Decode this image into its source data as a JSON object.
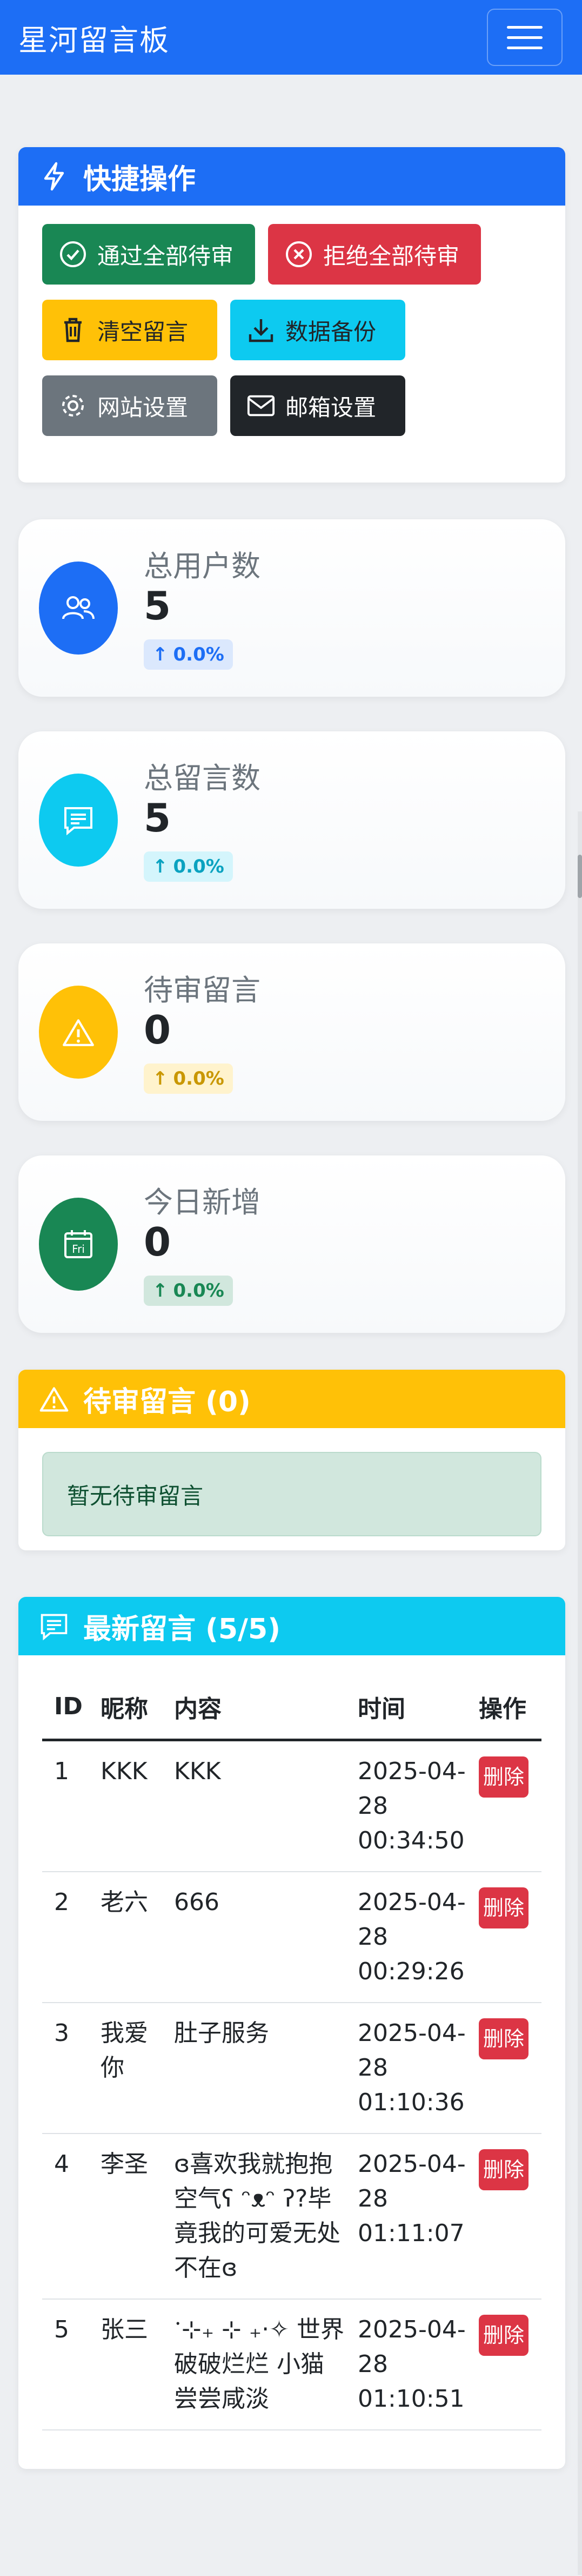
{
  "navbar": {
    "brand": "星河留言板"
  },
  "quick_actions": {
    "title": "快捷操作",
    "buttons": [
      {
        "label": "通过全部待审",
        "icon": "check-circle-icon",
        "color": "#198754"
      },
      {
        "label": "拒绝全部待审",
        "icon": "x-circle-icon",
        "color": "#dc3545"
      },
      {
        "label": "清空留言",
        "icon": "trash-icon",
        "color": "#ffc107"
      },
      {
        "label": "数据备份",
        "icon": "download-icon",
        "color": "#0dcaf0"
      },
      {
        "label": "网站设置",
        "icon": "gear-icon",
        "color": "#6c757d"
      },
      {
        "label": "邮箱设置",
        "icon": "envelope-icon",
        "color": "#212529"
      }
    ]
  },
  "stats": [
    {
      "title": "总用户数",
      "value": "5",
      "change": "0.0%",
      "icon": "users-icon",
      "color": "#1d6ef5"
    },
    {
      "title": "总留言数",
      "value": "5",
      "change": "0.0%",
      "icon": "chat-icon",
      "color": "#0dcaf0"
    },
    {
      "title": "待审留言",
      "value": "0",
      "change": "0.0%",
      "icon": "warning-icon",
      "color": "#ffc107"
    },
    {
      "title": "今日新增",
      "value": "0",
      "change": "0.0%",
      "icon": "calendar-icon",
      "color": "#198754",
      "icon_text": "Fri"
    }
  ],
  "pending": {
    "title": "待审留言 (0)",
    "empty_text": "暂无待审留言"
  },
  "latest": {
    "title": "最新留言 (5/5)",
    "columns": [
      "ID",
      "昵称",
      "内容",
      "时间",
      "操作"
    ],
    "delete_label": "删除",
    "rows": [
      {
        "id": "1",
        "nick": "KKK",
        "content": "KKK",
        "time": "2025-04-28 00:34:50"
      },
      {
        "id": "2",
        "nick": "老六",
        "content": "666",
        "time": "2025-04-28 00:29:26"
      },
      {
        "id": "3",
        "nick": "我爱你",
        "content": "肚子服务",
        "time": "2025-04-28 01:10:36"
      },
      {
        "id": "4",
        "nick": "李圣",
        "content": "ɞ喜欢我就抱抱空气ʕ ᵔᴥᵔ ʔ?毕竟我的可爱无处不在ɞ",
        "time": "2025-04-28 01:11:07"
      },
      {
        "id": "5",
        "nick": "张三",
        "content": "ॱ⊹₊ ⊹ ₊‧✧ 世界破破烂烂 小猫尝尝咸淡",
        "time": "2025-04-28 01:10:51"
      }
    ]
  }
}
